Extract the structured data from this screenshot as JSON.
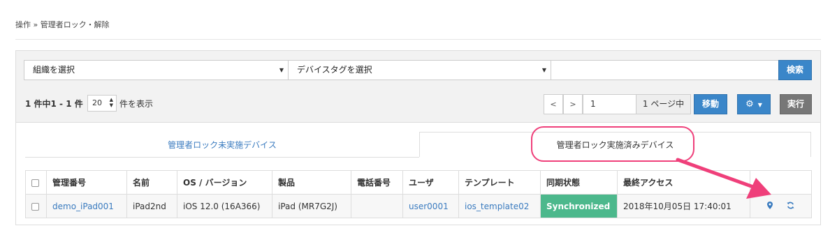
{
  "breadcrumb": "操作 » 管理者ロック・解除",
  "filters": {
    "organization_select": "組織を選択",
    "device_tag_select": "デバイスタグを選択",
    "search_value": "",
    "search_button": "検索"
  },
  "listing": {
    "count_text": "1 件中1 - 1 件",
    "page_size": "20",
    "show_text": "件を表示"
  },
  "pager": {
    "prev": "<",
    "next": ">",
    "current_page": "1",
    "page_of": "1 ページ中",
    "move_button": "移動",
    "gear_icon": "gear-icon",
    "exec_button": "実行"
  },
  "tabs": {
    "unlocked": "管理者ロック未実施デバイス",
    "locked": "管理者ロック実施済みデバイス",
    "active": "locked"
  },
  "table": {
    "headers": [
      "管理番号",
      "名前",
      "OS / バージョン",
      "製品",
      "電話番号",
      "ユーザ",
      "テンプレート",
      "同期状態",
      "最終アクセス"
    ],
    "rows": [
      {
        "id": "demo_iPad001",
        "name": "iPad2nd",
        "os": "iOS 12.0 (16A366)",
        "product": "iPad (MR7G2J)",
        "phone": "",
        "user": "user0001",
        "template": "ios_template02",
        "sync": "Synchronized",
        "last_access": "2018年10月05日 17:40:01",
        "actions": [
          "map-marker-icon",
          "refresh-icon"
        ]
      }
    ]
  },
  "colors": {
    "primary": "#3a86c9",
    "link": "#3a7bbf",
    "sync_green": "#4cb88c",
    "annotation_pink": "#ef3f7a",
    "exec_gray": "#777777"
  }
}
